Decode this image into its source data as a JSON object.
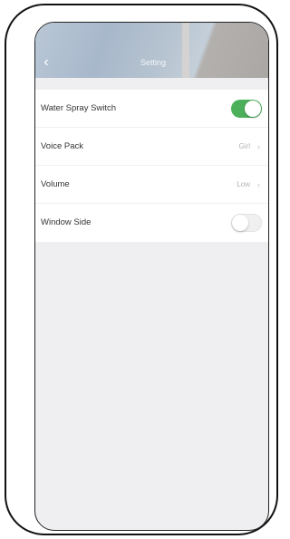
{
  "header": {
    "back_icon": "chevron-left-icon",
    "title": "Setting"
  },
  "settings": {
    "water_spray": {
      "label": "Water Spray Switch",
      "enabled": true
    },
    "voice_pack": {
      "label": "Voice Pack",
      "value": "Girl"
    },
    "volume": {
      "label": "Volume",
      "value": "Low"
    },
    "window_side": {
      "label": "Window Side",
      "enabled": false
    }
  },
  "colors": {
    "toggle_on": "#4cb05a",
    "toggle_off": "#f0f0f0",
    "background": "#efeff2"
  }
}
